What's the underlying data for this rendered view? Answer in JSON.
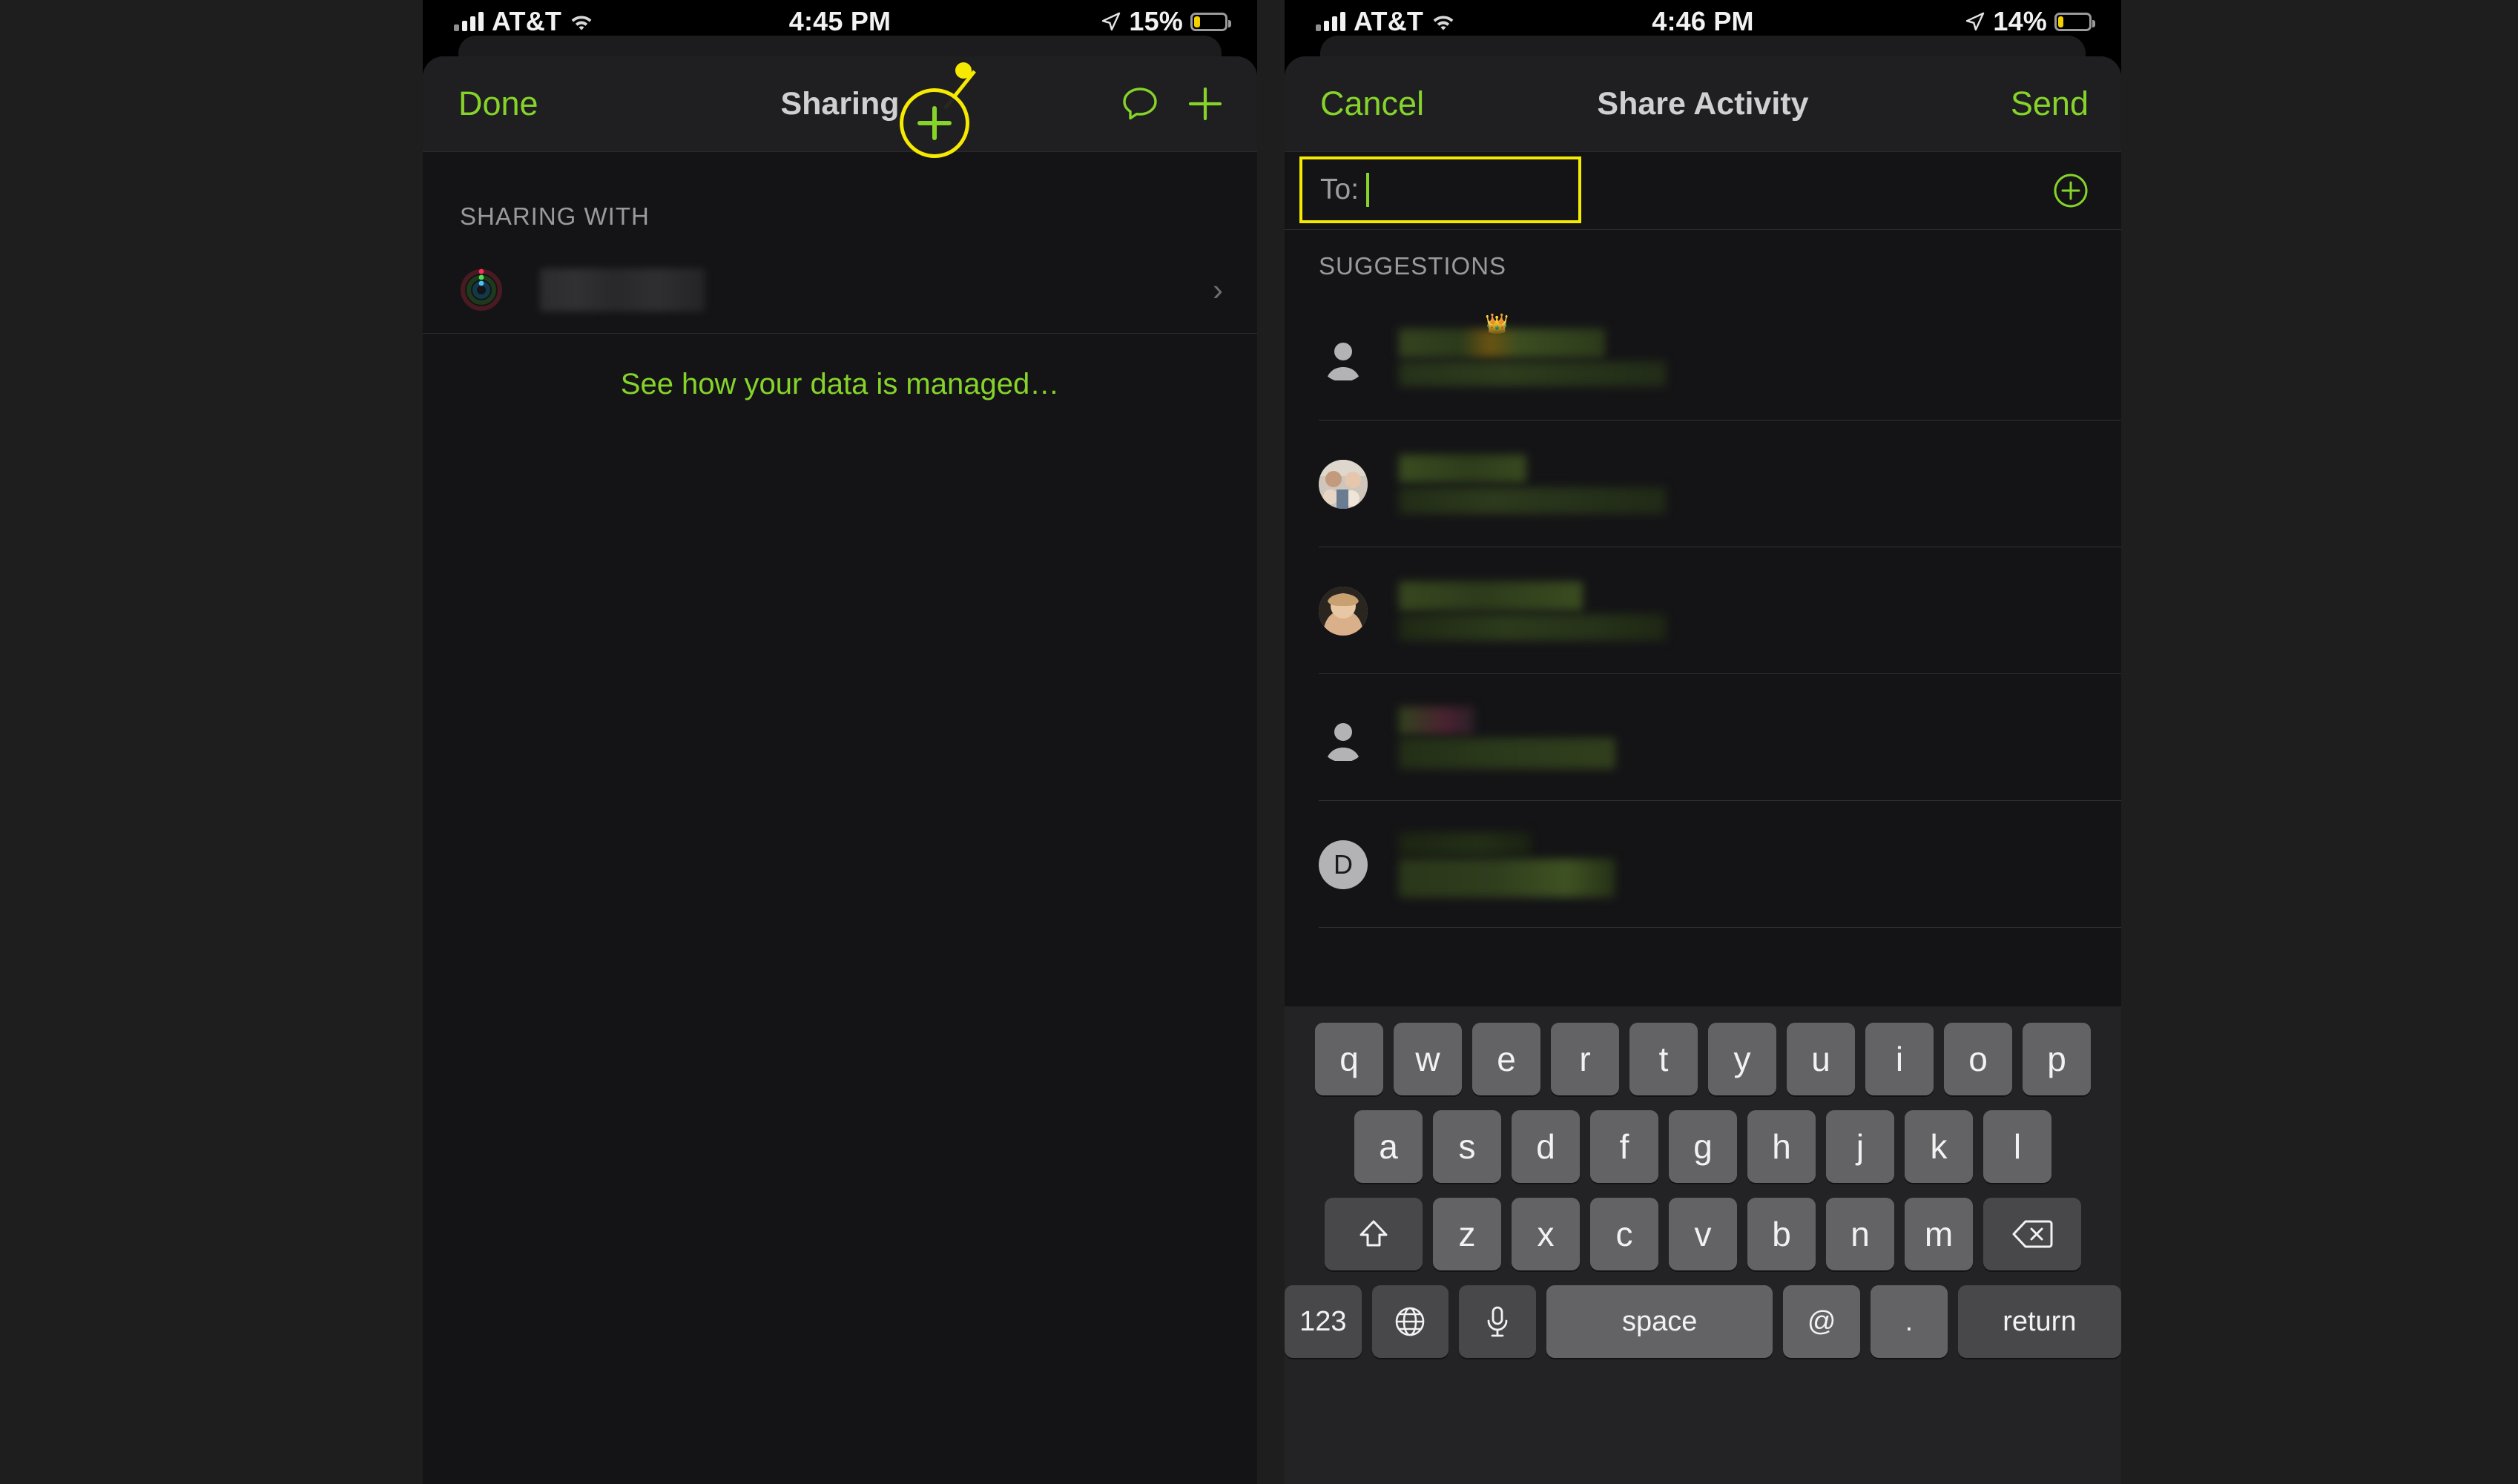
{
  "left_phone": {
    "status_bar": {
      "carrier": "AT&T",
      "time": "4:45 PM",
      "battery_percent": "15%",
      "signal_icon": "cellular-bars-icon",
      "wifi_icon": "wifi-icon",
      "location_icon": "location-arrow-icon",
      "battery_icon": "battery-low-icon",
      "battery_fill_color": "#f5d000"
    },
    "navbar": {
      "left_button": "Done",
      "title": "Sharing",
      "message_icon": "speech-bubble-icon",
      "add_icon": "plus-icon",
      "accent_color": "#86d32a"
    },
    "section_header": "SHARING WITH",
    "share_row": {
      "avatar_icon": "activity-rings-avatar",
      "name": "",
      "chevron_icon": "chevron-right-icon"
    },
    "footer_link": "See how your data is managed…",
    "annotation": {
      "shape": "circle-callout",
      "color": "#f5ea00",
      "target_icon": "plus-icon",
      "magnified_glyph": "+"
    }
  },
  "right_phone": {
    "status_bar": {
      "carrier": "AT&T",
      "time": "4:46 PM",
      "battery_percent": "14%",
      "signal_icon": "cellular-bars-icon",
      "wifi_icon": "wifi-icon",
      "location_icon": "location-arrow-icon",
      "battery_icon": "battery-low-icon",
      "battery_fill_color": "#f5d000"
    },
    "navbar": {
      "left_button": "Cancel",
      "title": "Share Activity",
      "right_button": "Send",
      "accent_color": "#86d32a"
    },
    "to_field": {
      "label": "To:",
      "value": "",
      "placeholder": "",
      "add_contact_icon": "plus-circle-icon",
      "highlight_color": "#f5ea00",
      "caret_color": "#86d32a"
    },
    "suggestions_header": "SUGGESTIONS",
    "suggestions": [
      {
        "avatar_icon": "person-silhouette-avatar",
        "name": "",
        "subtitle": "",
        "badge": "crown-emoji"
      },
      {
        "avatar_icon": "photo-avatar-group",
        "name": "",
        "subtitle": ""
      },
      {
        "avatar_icon": "photo-avatar-portrait",
        "name": "",
        "subtitle": ""
      },
      {
        "avatar_icon": "person-silhouette-avatar",
        "name": "",
        "subtitle": ""
      },
      {
        "avatar_icon": "monogram-avatar",
        "monogram": "D",
        "name": "",
        "subtitle": ""
      }
    ],
    "keyboard": {
      "row1": [
        "q",
        "w",
        "e",
        "r",
        "t",
        "y",
        "u",
        "i",
        "o",
        "p"
      ],
      "row2": [
        "a",
        "s",
        "d",
        "f",
        "g",
        "h",
        "j",
        "k",
        "l"
      ],
      "row3_letters": [
        "z",
        "x",
        "c",
        "v",
        "b",
        "n",
        "m"
      ],
      "shift_icon": "shift-arrow-icon",
      "backspace_icon": "backspace-delete-icon",
      "numbers_key": "123",
      "globe_icon": "globe-language-icon",
      "mic_icon": "microphone-icon",
      "space_key": "space",
      "at_key": "@",
      "period_key": ".",
      "return_key": "return"
    }
  }
}
